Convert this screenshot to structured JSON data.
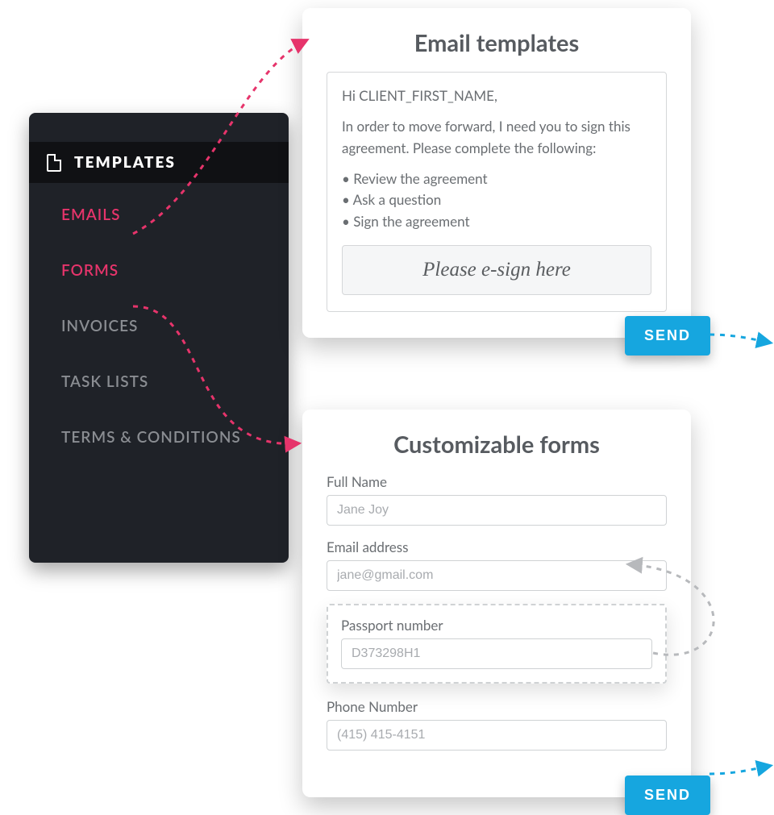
{
  "sidebar": {
    "header": "TEMPLATES",
    "items": [
      {
        "label": "EMAILS",
        "active": true
      },
      {
        "label": "FORMS",
        "active": true
      },
      {
        "label": "INVOICES",
        "active": false
      },
      {
        "label": "TASK LISTS",
        "active": false
      },
      {
        "label": "TERMS & CONDITIONS",
        "active": false
      }
    ]
  },
  "email_card": {
    "title": "Email templates",
    "greeting": "Hi CLIENT_FIRST_NAME,",
    "intro": "In order to move forward, I need you to sign this agreement. Please complete the following:",
    "bullets": [
      "Review the agreement",
      "Ask a question",
      "Sign the agreement"
    ],
    "esign_placeholder": "Please e-sign here",
    "send_label": "SEND"
  },
  "forms_card": {
    "title": "Customizable forms",
    "fields": {
      "full_name": {
        "label": "Full Name",
        "placeholder": "Jane Joy"
      },
      "email": {
        "label": "Email address",
        "placeholder": "jane@gmail.com"
      },
      "passport": {
        "label": "Passport number",
        "placeholder": "D373298H1"
      },
      "phone": {
        "label": "Phone Number",
        "placeholder": "(415) 415-4151"
      }
    },
    "send_label": "SEND"
  }
}
